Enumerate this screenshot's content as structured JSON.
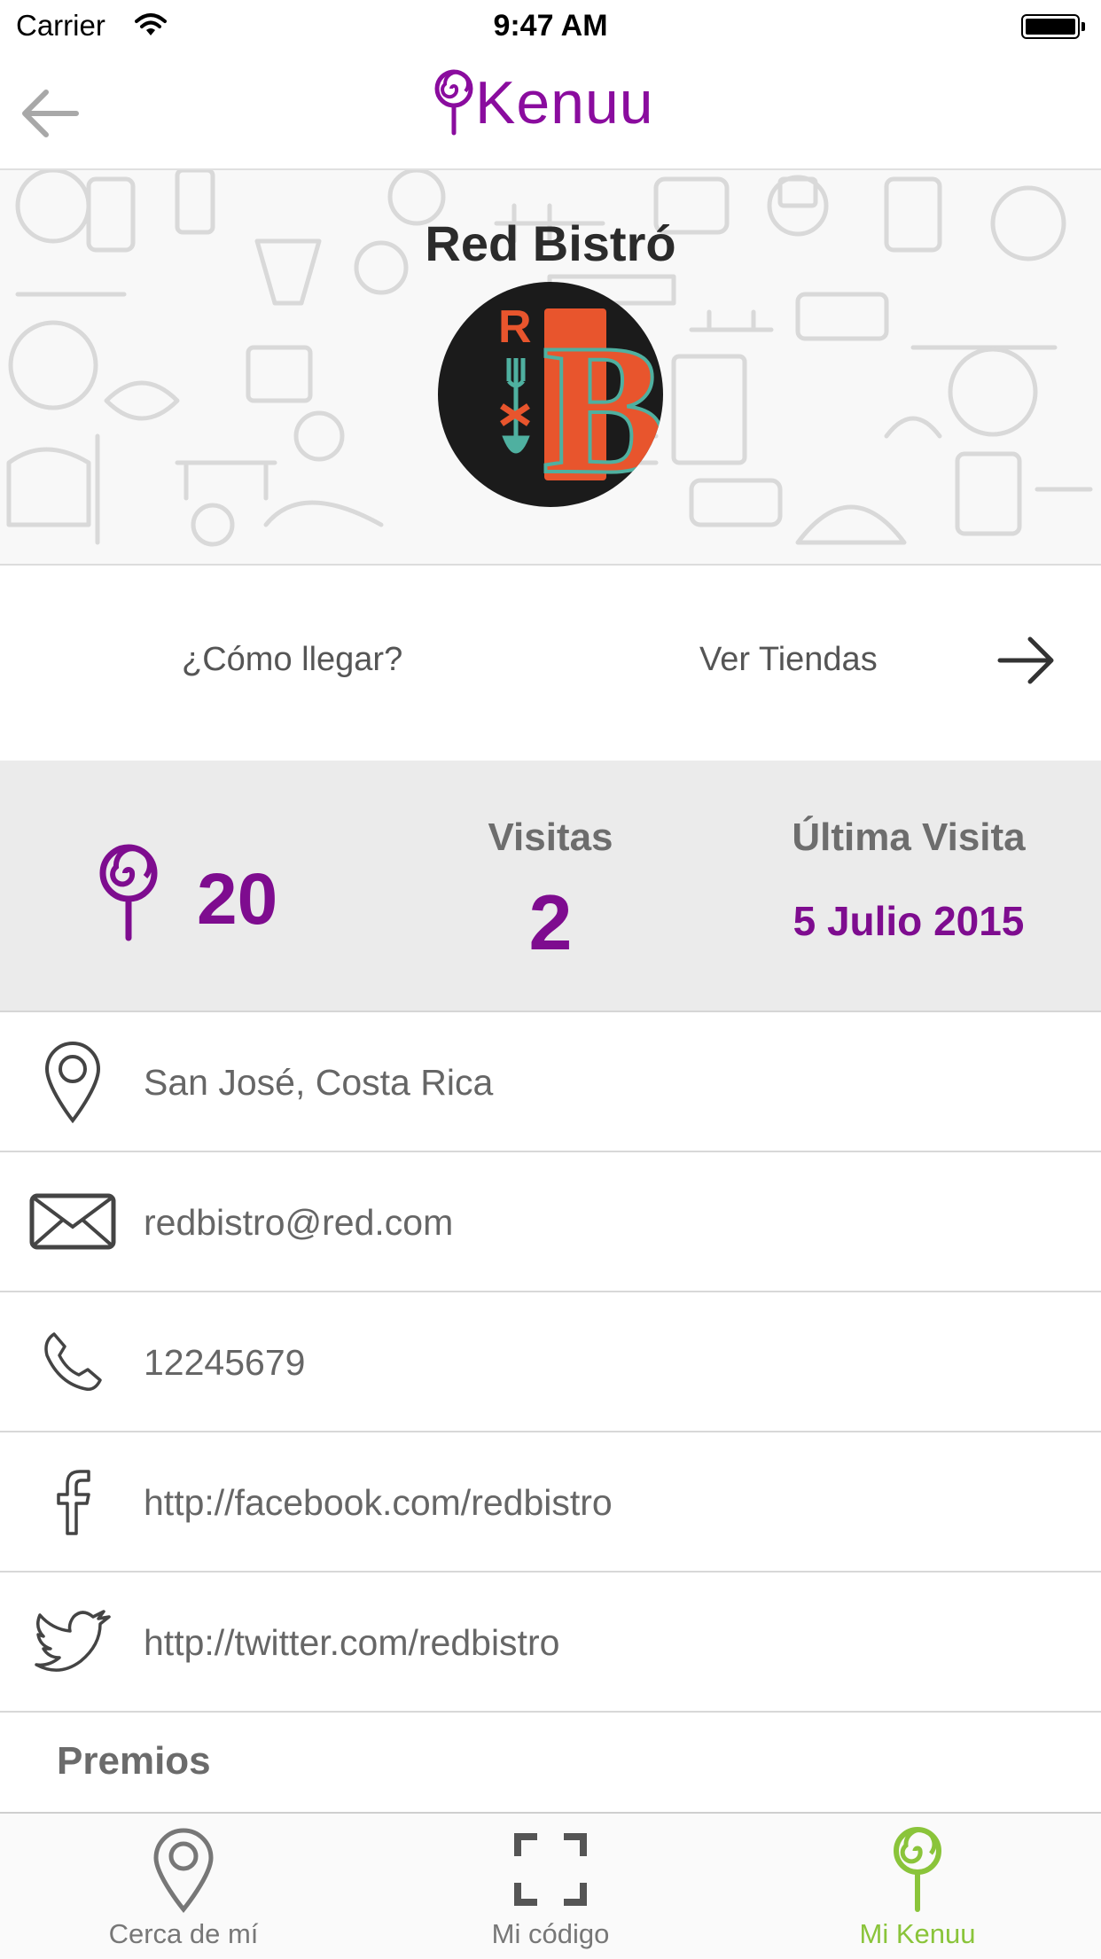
{
  "status_bar": {
    "carrier": "Carrier",
    "time": "9:47 AM"
  },
  "nav": {
    "brand": "Kenuu",
    "brand_color": "#8a0c9e"
  },
  "store": {
    "name": "Red Bistró",
    "logo_letters": [
      "R",
      "B"
    ]
  },
  "actions": {
    "directions": "¿Cómo llegar?",
    "stores": "Ver Tiendas"
  },
  "stats": {
    "points": "20",
    "visits_label": "Visitas",
    "visits_value": "2",
    "last_visit_label": "Última Visita",
    "last_visit_value": "5 Julio 2015",
    "accent_color": "#7e0c8f"
  },
  "info": [
    {
      "icon": "location-pin-icon",
      "text": "San José, Costa Rica"
    },
    {
      "icon": "envelope-icon",
      "text": "redbistro@red.com"
    },
    {
      "icon": "phone-icon",
      "text": "12245679"
    },
    {
      "icon": "facebook-icon",
      "text": "http://facebook.com/redbistro"
    },
    {
      "icon": "twitter-icon",
      "text": "http://twitter.com/redbistro"
    }
  ],
  "rewards_title": "Premios",
  "tabs": [
    {
      "icon": "location-pin-icon",
      "label": "Cerca de mí",
      "active": false
    },
    {
      "icon": "qr-scan-icon",
      "label": "Mi código",
      "active": false
    },
    {
      "icon": "kenuu-lollipop-icon",
      "label": "Mi Kenuu",
      "active": true
    }
  ],
  "active_tab_color": "#8ac43a"
}
